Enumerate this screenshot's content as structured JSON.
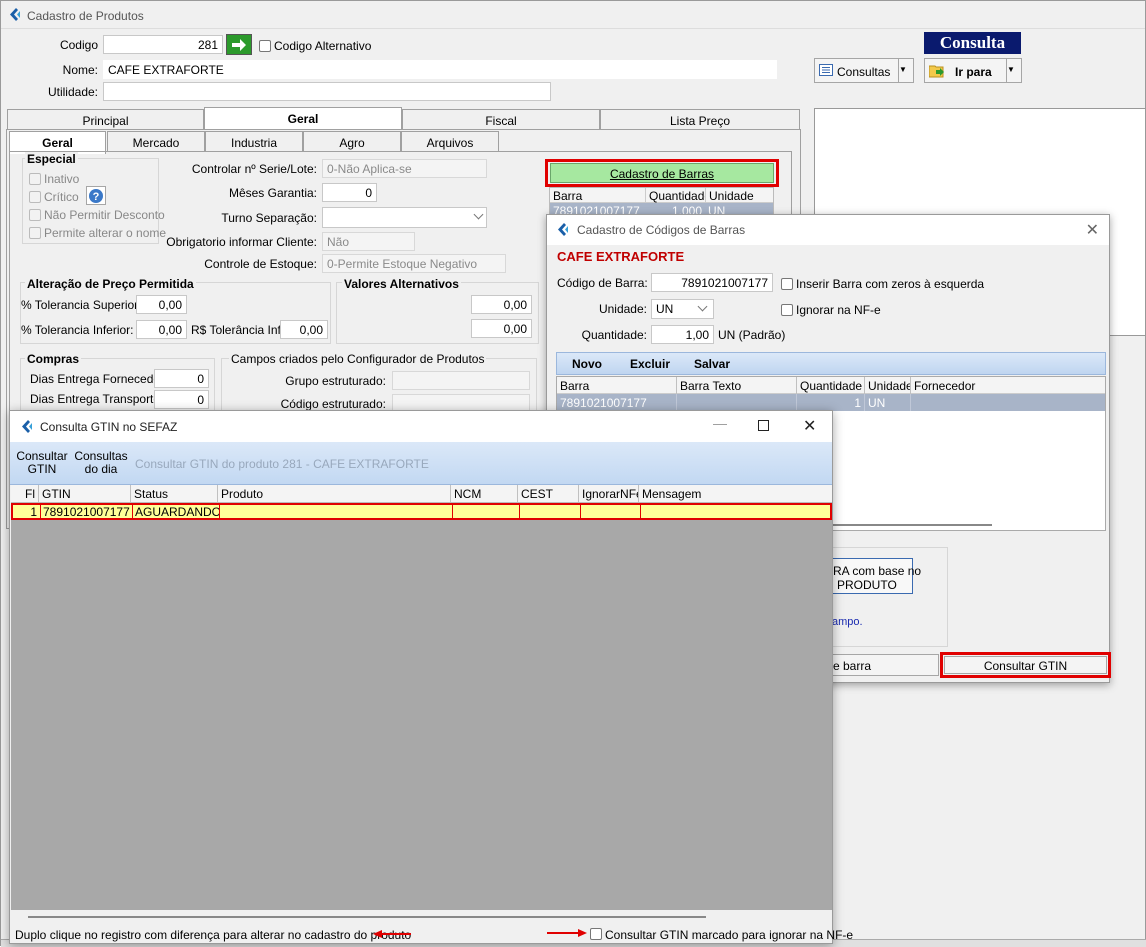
{
  "main": {
    "title": "Cadastro de Produtos",
    "codigo_label": "Codigo",
    "codigo_value": "281",
    "codigo_alt_label": "Codigo Alternativo",
    "nome_label": "Nome:",
    "nome_value": "CAFE EXTRAFORTE",
    "utilidade_label": "Utilidade:",
    "consulta_header": "Consulta",
    "consultas_btn": "Consultas",
    "irpara_btn": "Ir para",
    "tabs_top": [
      "Principal",
      "Geral",
      "Fiscal",
      "Lista Preço"
    ],
    "tabs_sub": [
      "Geral",
      "Mercado",
      "Industria",
      "Agro",
      "Arquivos"
    ],
    "especial": {
      "title": "Especial",
      "items": [
        "Inativo",
        "Crítico",
        "Não Permitir Desconto",
        "Permite alterar o nome"
      ]
    },
    "controlar_serie_label": "Controlar nº Serie/Lote:",
    "controlar_serie_value": "0-Não Aplica-se",
    "meses_garantia_label": "Mêses Garantia:",
    "meses_garantia_value": "0",
    "turno_label": "Turno Separação:",
    "obrigatorio_label": "Obrigatorio informar Cliente:",
    "obrigatorio_value": "Não",
    "controle_estoque_label": "Controle de Estoque:",
    "controle_estoque_value": "0-Permite Estoque Negativo",
    "cadastro_barras_btn": "Cadastro de Barras",
    "barras_headers": [
      "Barra",
      "Quantidade",
      "Unidade"
    ],
    "barras_row": [
      "7891021007177",
      "1,000",
      "UN"
    ],
    "alteracao": {
      "title": "Alteração de Preço Permitida",
      "sup_label": "% Tolerancia Superior:",
      "sup_value": "0,00",
      "inf_label": "% Tolerancia Inferior:",
      "inf_value": "0,00",
      "rs_label": "R$ Tolerância Inf:",
      "rs_value": "0,00"
    },
    "valores_alt": {
      "title": "Valores Alternativos",
      "v1": "0,00",
      "v2": "0,00"
    },
    "compras": {
      "title": "Compras",
      "forn_label": "Dias Entrega Fornecedor:",
      "forn_value": "0",
      "transp_label": "Dias Entrega Transporte:",
      "transp_value": "0"
    },
    "campos": {
      "title": "Campos criados pelo Configurador de Produtos",
      "grupo_label": "Grupo estruturado:",
      "codigo_label": "Código estruturado:"
    }
  },
  "barras_dialog": {
    "title": "Cadastro de Códigos de Barras",
    "product": "CAFE EXTRAFORTE",
    "codigo_barra_label": "Código de Barra:",
    "codigo_barra_value": "7891021007177",
    "inserir_zeros_label": "Inserir Barra com zeros à esquerda",
    "unidade_label": "Unidade:",
    "unidade_value": "UN",
    "ignorar_nfe_label": "Ignorar na NF-e",
    "quantidade_label": "Quantidade:",
    "quantidade_value": "1,00",
    "quantidade_unit": "UN (Padrão)",
    "toolbar": [
      "Novo",
      "Excluir",
      "Salvar"
    ],
    "headers": [
      "Barra",
      "Barra Texto",
      "Quantidade",
      "Unidade",
      "Fornecedor"
    ],
    "row": [
      "7891021007177",
      "",
      "1",
      "UN",
      ""
    ],
    "partial_btn_line1": "RA com base no",
    "partial_btn_line2": "PRODUTO",
    "partial_text": "ampo.",
    "barra_btn": "e barra",
    "consultar_gtin_btn": "Consultar GTIN"
  },
  "gtin_dialog": {
    "title": "Consulta GTIN no SEFAZ",
    "btn_consultar_1": "Consultar",
    "btn_consultar_2": "GTIN",
    "btn_consultas_1": "Consultas",
    "btn_consultas_2": "do dia",
    "info": "Consultar GTIN do produto 281 - CAFE EXTRAFORTE",
    "headers": [
      "Fl",
      "GTIN",
      "Status",
      "Produto",
      "NCM",
      "CEST",
      "IgnorarNFe",
      "Mensagem"
    ],
    "row": [
      "1",
      "7891021007177",
      "AGUARDANDO",
      "",
      "",
      "",
      "",
      ""
    ],
    "footer_hint": "Duplo clique no registro com diferença para alterar no cadastro do produto",
    "footer_check": "Consultar GTIN marcado para ignorar na NF-e"
  },
  "colors": {
    "accent_green": "#a6e8a0",
    "highlight_red": "#e00000",
    "row_yellow": "#ffff99",
    "grid_gray": "#a8a8a8",
    "toolbar_blue": "#cfe2f7"
  }
}
